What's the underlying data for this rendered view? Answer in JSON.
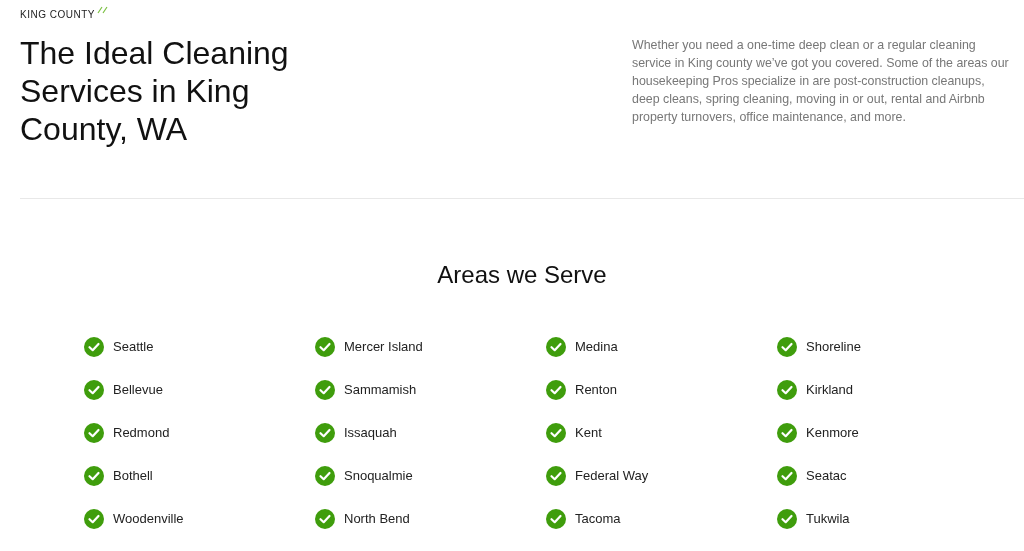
{
  "eyebrow": "KING COUNTY",
  "heading": "The Ideal Cleaning Services in King County, WA",
  "intro": "Whether you need a one-time deep clean or a regular cleaning service in King county we’ve got you covered. Some of the areas our housekeeping Pros specialize in are post-construction cleanups, deep cleans, spring cleaning, moving in or out, rental and Airbnb property turnovers, office maintenance, and more.",
  "areas": {
    "title": "Areas we Serve",
    "items": [
      "Seattle",
      "Mercer Island",
      "Medina",
      "Shoreline",
      "Bellevue",
      "Sammamish",
      "Renton",
      "Kirkland",
      "Redmond",
      "Issaquah",
      "Kent",
      "Kenmore",
      "Bothell",
      "Snoqualmie",
      "Federal Way",
      "Seatac",
      "Woodenville",
      "North Bend",
      "Tacoma",
      "Tukwila"
    ]
  }
}
